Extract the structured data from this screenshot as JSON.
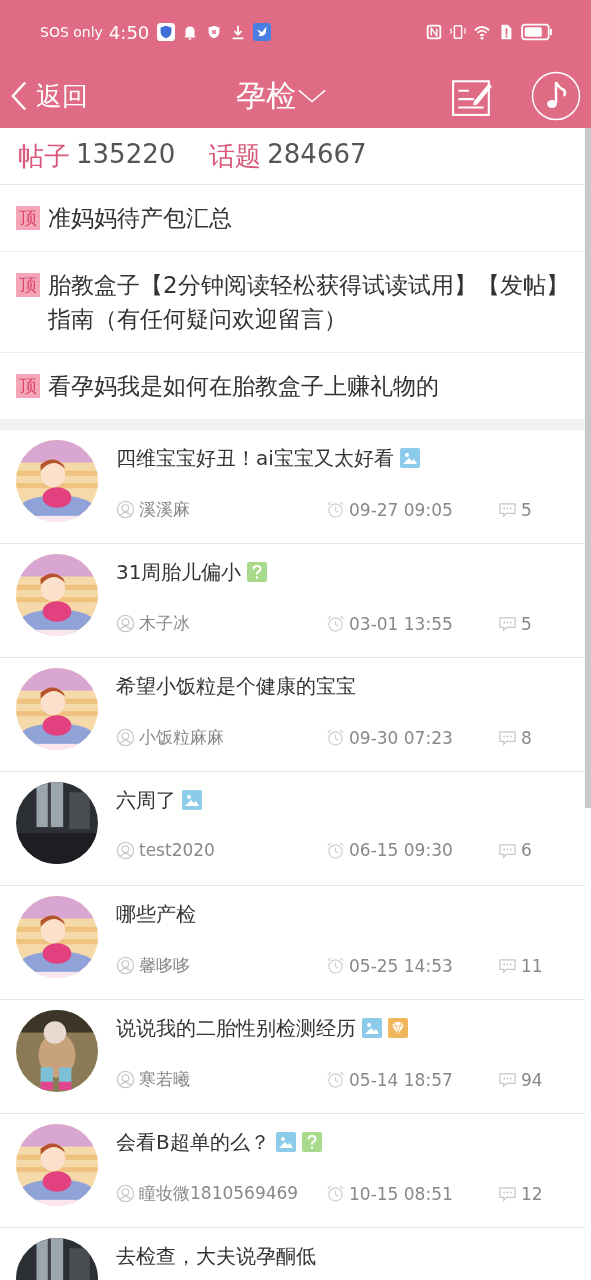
{
  "status_bar": {
    "carrier": "SOS only",
    "time": "4:50"
  },
  "nav": {
    "back": "返回",
    "title": "孕检"
  },
  "stats": [
    {
      "label": "帖子",
      "value": "135220"
    },
    {
      "label": "话题",
      "value": "284667"
    }
  ],
  "pinned": [
    {
      "badge": "顶",
      "title": "准妈妈待产包汇总"
    },
    {
      "badge": "顶",
      "title": "胎教盒子【2分钟阅读轻松获得试读试用】【发帖】指南（有任何疑问欢迎留言）"
    },
    {
      "badge": "顶",
      "title": "看孕妈我是如何在胎教盒子上赚礼物的"
    }
  ],
  "posts": [
    {
      "title": "四维宝宝好丑！ai宝宝又太好看",
      "has_image": true,
      "is_question": false,
      "is_featured": false,
      "author": "溪溪麻",
      "time": "09-27 09:05",
      "replies": "5"
    },
    {
      "title": "31周胎儿偏小",
      "has_image": false,
      "is_question": true,
      "is_featured": false,
      "author": "木子冰",
      "time": "03-01 13:55",
      "replies": "5"
    },
    {
      "title": "希望小饭粒是个健康的宝宝",
      "has_image": false,
      "is_question": false,
      "is_featured": false,
      "author": "小饭粒麻麻",
      "time": "09-30 07:23",
      "replies": "8"
    },
    {
      "title": "六周了",
      "has_image": true,
      "is_question": false,
      "is_featured": false,
      "author": "test2020",
      "time": "06-15 09:30",
      "replies": "6"
    },
    {
      "title": "哪些产检",
      "has_image": false,
      "is_question": false,
      "is_featured": false,
      "author": "馨哆哆",
      "time": "05-25 14:53",
      "replies": "11"
    },
    {
      "title": "说说我的二胎性别检测经历",
      "has_image": true,
      "is_question": false,
      "is_featured": true,
      "author": "寒若曦",
      "time": "05-14 18:57",
      "replies": "94"
    },
    {
      "title": "会看B超单的么？",
      "has_image": true,
      "is_question": true,
      "is_featured": false,
      "author": "瞳妆微1810569469",
      "time": "10-15 08:51",
      "replies": "12"
    },
    {
      "title": "去检查，大夫说孕酮低",
      "has_image": false,
      "is_question": false,
      "is_featured": false
    }
  ]
}
